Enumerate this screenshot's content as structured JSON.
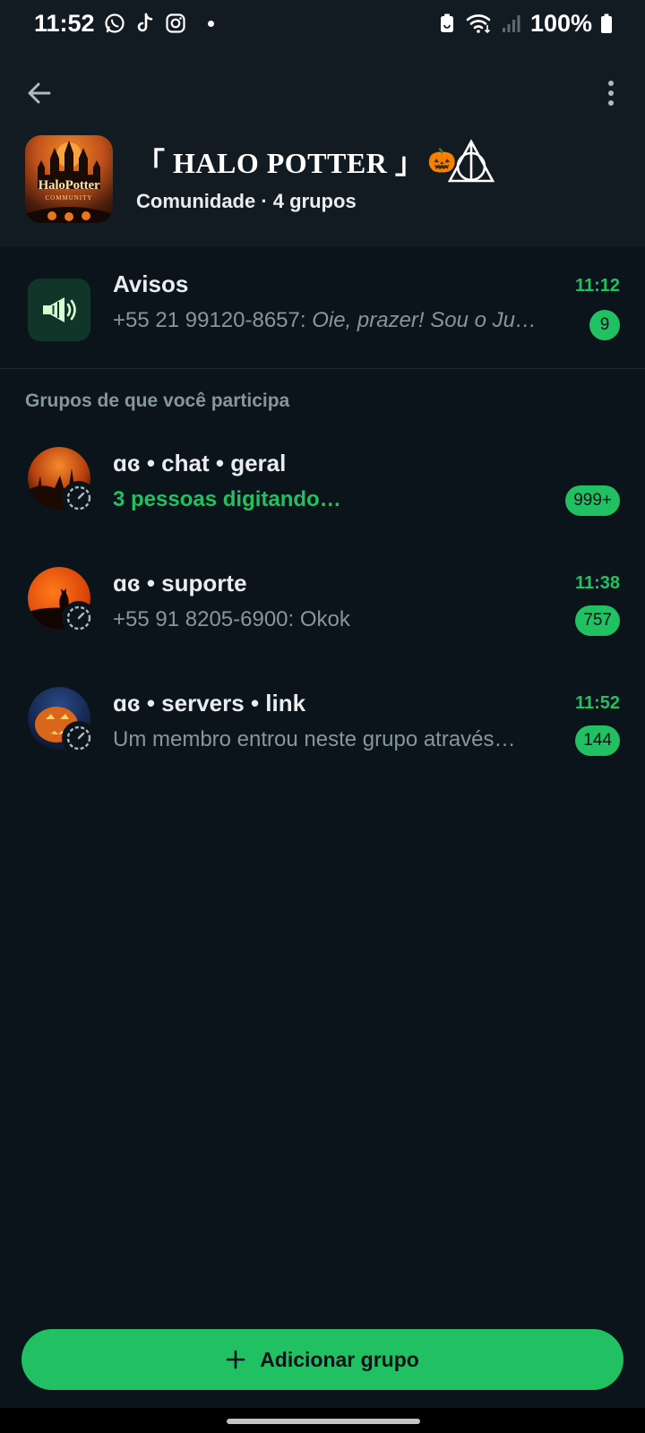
{
  "status_bar": {
    "time": "11:52",
    "battery": "100%",
    "icons": [
      "whatsapp-icon",
      "tiktok-icon",
      "instagram-icon",
      "battery-saver-icon",
      "wifi-icon",
      "signal-icon",
      "battery-icon"
    ]
  },
  "header": {
    "title": "「 HALO POTTER 」",
    "title_emoji": "🎃",
    "subtitle": "Comunidade · 4 grupos",
    "avatar_text": "HaloPotter",
    "avatar_subtext": "COMMUNITY"
  },
  "announcements": {
    "name": "Avisos",
    "time": "11:12",
    "sender": "+55 21 99120‑8657:",
    "message": "Oie, prazer! Sou o Ju…",
    "unread": "9"
  },
  "section_label": "Grupos de que você participa",
  "groups": [
    {
      "name": "ɑɞ • chat • geral",
      "time": "",
      "preview": "3 pessoas digitando…",
      "typing": true,
      "unread": "999+"
    },
    {
      "name": "ɑɞ • suporte",
      "time": "11:38",
      "preview": "+55 91 8205‑6900: Okok",
      "typing": false,
      "unread": "757"
    },
    {
      "name": "ɑɞ • servers • link",
      "time": "11:52",
      "preview": "Um membro entrou neste grupo através…",
      "typing": false,
      "unread": "144"
    }
  ],
  "add_group_label": "Adicionar grupo",
  "colors": {
    "accent": "#21c063",
    "background": "#0b141a",
    "header": "#121b22",
    "muted_text": "#8696a0"
  }
}
